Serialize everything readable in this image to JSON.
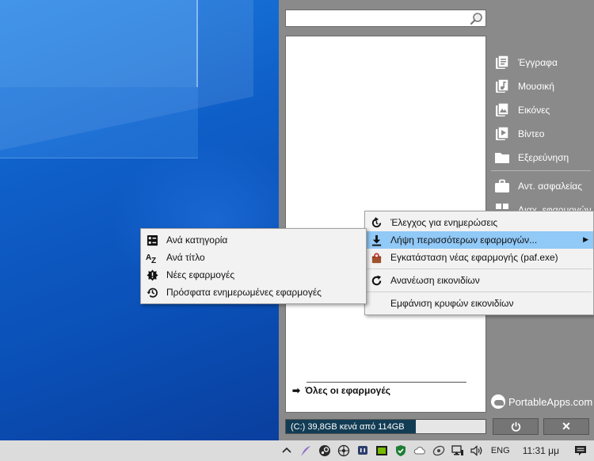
{
  "search": {
    "placeholder": "",
    "value": ""
  },
  "applist": {
    "all_apps_label": "Όλες οι εφαρμογές"
  },
  "drive": {
    "text": "(C:) 39,8GB κενά από 114GB",
    "used_fraction": 0.65
  },
  "right_links": [
    {
      "label": "Έγγραφα",
      "icon": "documents-icon"
    },
    {
      "label": "Μουσική",
      "icon": "music-icon"
    },
    {
      "label": "Εικόνες",
      "icon": "pictures-icon"
    },
    {
      "label": "Βίντεο",
      "icon": "video-icon"
    },
    {
      "label": "Εξερεύνηση",
      "icon": "folder-icon"
    }
  ],
  "right_links2": [
    {
      "label": "Αντ. ασφαλείας",
      "icon": "briefcase-icon"
    },
    {
      "label": "Διαχ. εφαρμογών",
      "icon": "apps-icon"
    }
  ],
  "brand": "PortableApps.com",
  "context_menu": {
    "items": [
      {
        "label": "Έλεγχος για ενημερώσεις",
        "icon": "update-check-icon"
      },
      {
        "label": "Λήψη περισσότερων εφαρμογών...",
        "icon": "download-icon",
        "highlighted": true,
        "submenu": true
      },
      {
        "label": "Εγκατάσταση νέας εφαρμογής (paf.exe)",
        "icon": "install-package-icon"
      },
      {
        "label": "Ανανέωση εικονιδίων",
        "icon": "refresh-icon"
      },
      {
        "label": "Εμφάνιση κρυφών εικονιδίων",
        "icon": ""
      }
    ]
  },
  "submenu": {
    "items": [
      {
        "label": "Ανά κατηγορία",
        "icon": "category-icon"
      },
      {
        "label": "Ανά τίτλο",
        "icon": "sort-az-icon"
      },
      {
        "label": "Νέες εφαρμογές",
        "icon": "new-badge-icon"
      },
      {
        "label": "Πρόσφατα ενημερωμένες εφαρμογές",
        "icon": "history-icon"
      }
    ]
  },
  "taskbar": {
    "language": "ENG",
    "time": "11:31 μμ"
  },
  "colors": {
    "panel": "#8a8a8a",
    "highlight": "#91c9f7",
    "drive_fill": "#123c54"
  }
}
